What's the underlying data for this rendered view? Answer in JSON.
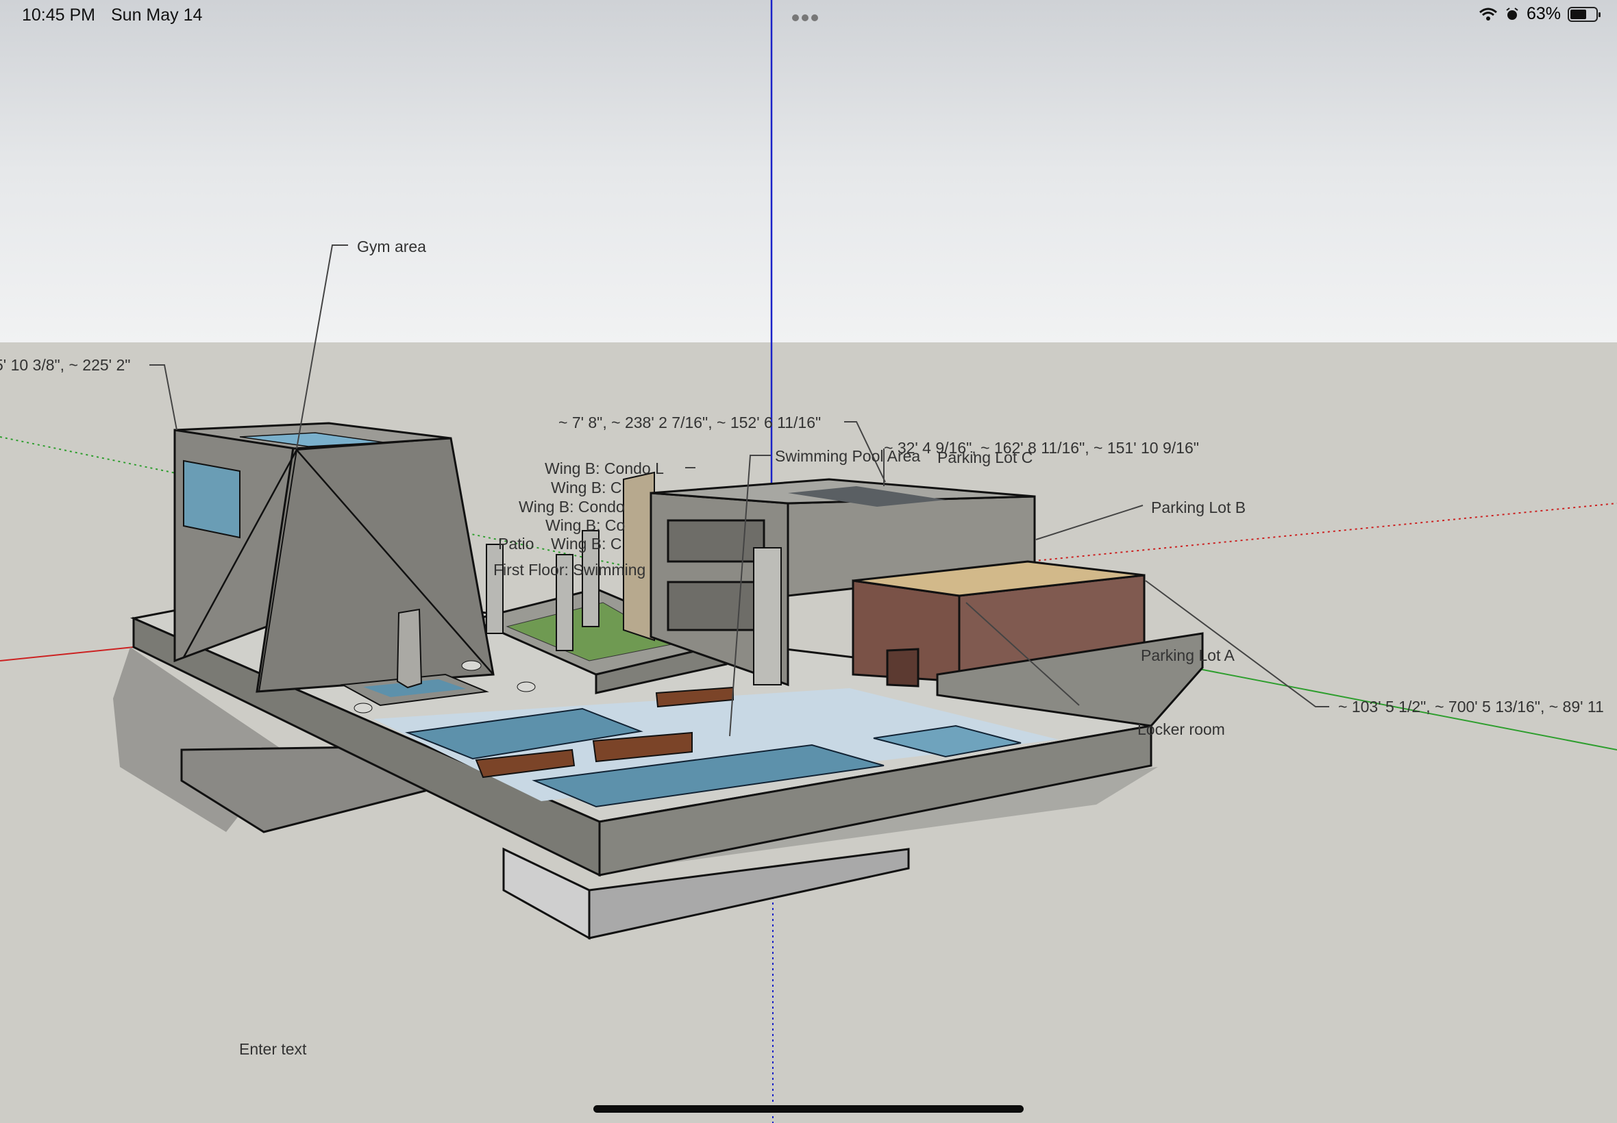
{
  "status_bar": {
    "time": "10:45 PM",
    "date": "Sun May 14",
    "battery_text": "63%",
    "battery_level": 0.63,
    "icons": [
      "wifi-icon",
      "alarm-icon",
      "battery-icon"
    ],
    "multitask_icon": "more-dots-icon"
  },
  "viewport": {
    "sky_color": "#e6e8ea",
    "ground_color": "#cdccc6",
    "axis_colors": {
      "red": "#cc2222",
      "green": "#2e9e2e",
      "blue": "#1a22c8"
    }
  },
  "labels": {
    "gym_area": "Gym area",
    "coord_left": "5' 10 3/8\", ~ 225' 2\"",
    "coord_top": "~ 7' 8\", ~ 238' 2 7/16\", ~ 152' 6 11/16\"",
    "swimming_pool_area": "Swimming Pool Area",
    "coord_mid": "~ 32' 4 9/16\", ~ 162' 8 11/16\", ~ 151' 10 9/16\"",
    "parking_lot_c": "Parking Lot C",
    "parking_lot_b": "Parking Lot B",
    "parking_lot_a": "Parking Lot A",
    "locker_room": "Locker room",
    "coord_right": "~ 103' 5 1/2\", ~ 700' 5 13/16\", ~ 89' 11",
    "wing_b_1": "Wing B: Condo L",
    "wing_b_2": "Wing B: C",
    "wing_b_3": "Wing B: Condo",
    "wing_b_4": "Wing B: Co",
    "patio": "Patio",
    "wing_b_5": "Wing B: C",
    "first_floor": "First Floor: Swimming",
    "enter_text": "Enter text"
  }
}
